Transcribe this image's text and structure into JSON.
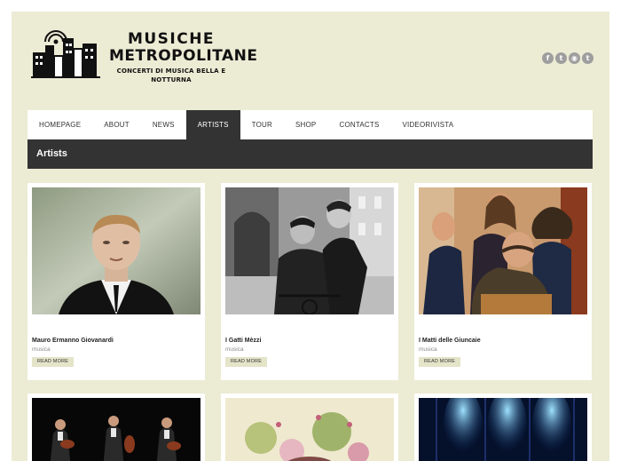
{
  "site": {
    "logo_line1": "MUSICHE",
    "logo_line2": "METROPOLITANE",
    "logo_tagline": "CONCERTI DI MUSICA BELLA E NOTTURNA"
  },
  "social": [
    {
      "icon": "facebook-icon",
      "glyph": "f"
    },
    {
      "icon": "twitter-icon",
      "glyph": "t"
    },
    {
      "icon": "rss-icon",
      "glyph": "◉"
    },
    {
      "icon": "tumblr-icon",
      "glyph": "t"
    }
  ],
  "nav": {
    "items": [
      "HOMEPAGE",
      "ABOUT",
      "NEWS",
      "ARTISTS",
      "TOUR",
      "SHOP",
      "CONTACTS",
      "VIDEORIVISTA"
    ],
    "active": "ARTISTS"
  },
  "section": {
    "title": "Artists"
  },
  "artists": [
    {
      "name": "Mauro Ermanno Giovanardi",
      "category": "musica",
      "button": "READ MORE"
    },
    {
      "name": "I Gatti Mèzzi",
      "category": "musica",
      "button": "READ MORE"
    },
    {
      "name": "I Matti delle Giuncaie",
      "category": "musica",
      "button": "READ MORE"
    }
  ],
  "colors": {
    "background": "#ecebd4",
    "nav_active": "#333333",
    "section_bar": "#333333",
    "button_bg": "#e4e4c9"
  }
}
